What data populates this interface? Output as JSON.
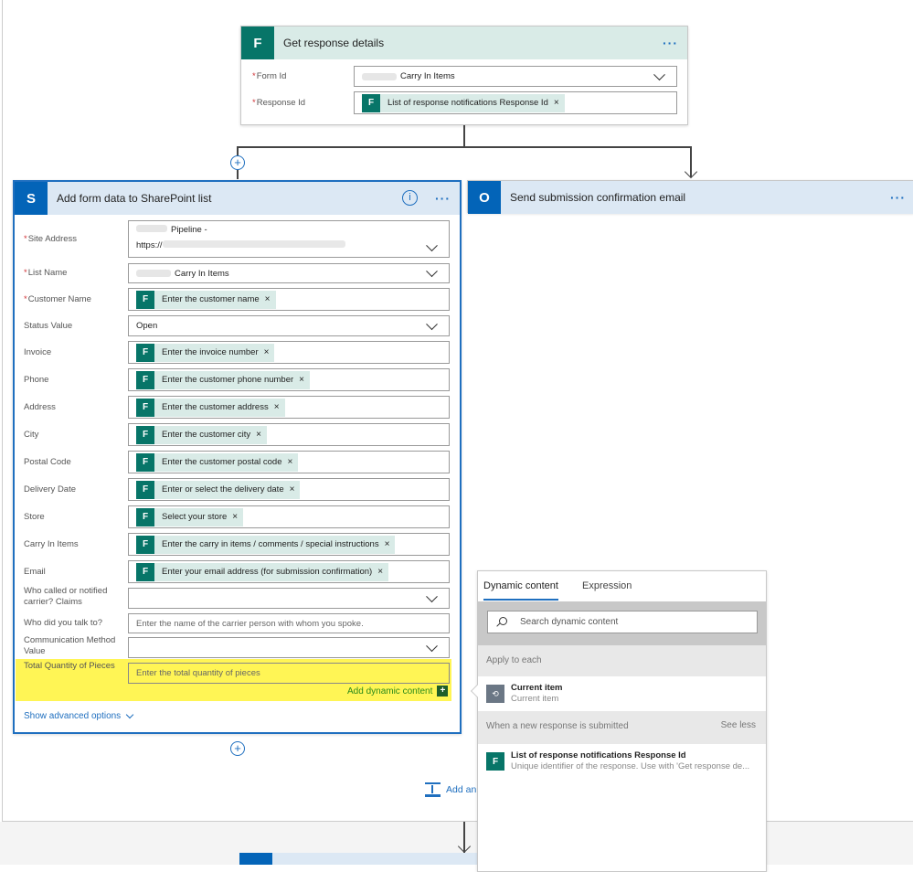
{
  "get_response": {
    "title": "Get response details",
    "icon": "forms-icon",
    "more": "···",
    "fields": [
      {
        "label": "Form Id",
        "required": true,
        "value": "Carry In Items",
        "type": "dropdown"
      },
      {
        "label": "Response Id",
        "required": true,
        "token": "List of response notifications Response Id",
        "type": "token"
      }
    ]
  },
  "sharepoint": {
    "title": "Add form data to SharePoint list",
    "icon": "sharepoint-icon",
    "icon_letter": "S",
    "info": "i",
    "more": "···",
    "site_line1": "Pipeline -",
    "site_line2": "https://",
    "fields": [
      {
        "label": "Site Address",
        "required": true,
        "type": "site"
      },
      {
        "label": "List Name",
        "required": true,
        "type": "dropdown",
        "value": "Carry In Items",
        "blur": true
      },
      {
        "label": "Customer Name",
        "required": true,
        "type": "token",
        "token": "Enter the customer name"
      },
      {
        "label": "Status Value",
        "type": "dropdown",
        "value": "Open"
      },
      {
        "label": "Invoice",
        "type": "token",
        "token": "Enter the invoice number"
      },
      {
        "label": "Phone",
        "type": "token",
        "token": "Enter the customer phone number"
      },
      {
        "label": "Address",
        "type": "token",
        "token": "Enter the customer address"
      },
      {
        "label": "City",
        "type": "token",
        "token": "Enter the customer city"
      },
      {
        "label": "Postal Code",
        "type": "token",
        "token": "Enter the customer postal code"
      },
      {
        "label": "Delivery Date",
        "type": "token",
        "token": "Enter or select the delivery date"
      },
      {
        "label": "Store",
        "type": "token",
        "token": "Select your store"
      },
      {
        "label": "Carry In Items",
        "type": "token",
        "token": "Enter the carry in items / comments / special instructions"
      },
      {
        "label": "Email",
        "type": "token",
        "token": "Enter your email address (for submission confirmation)"
      },
      {
        "label": "Who called or notified carrier? Claims",
        "type": "dropdown",
        "value": ""
      },
      {
        "label": "Who did you talk to?",
        "type": "text",
        "placeholder": "Enter the name of the carrier person with whom you spoke."
      },
      {
        "label": "Communication Method Value",
        "type": "dropdown",
        "value": ""
      },
      {
        "label": "Total Quantity of Pieces",
        "type": "text",
        "placeholder": "Enter the total quantity of pieces",
        "highlight": true
      }
    ],
    "add_dynamic": "Add dynamic content",
    "show_advanced": "Show advanced options"
  },
  "outlook": {
    "title": "Send submission confirmation email",
    "icon": "outlook-icon",
    "icon_letter": "O",
    "more": "···"
  },
  "add_action": "Add an",
  "dynamic_panel": {
    "tabs": [
      "Dynamic content",
      "Expression"
    ],
    "active_tab": 0,
    "search_placeholder": "Search dynamic content",
    "sections": [
      {
        "title": "Apply to each",
        "items": [
          {
            "title": "Current item",
            "subtitle": "Current item",
            "icon": "loop-icon"
          }
        ]
      },
      {
        "title": "When a new response is submitted",
        "action": "See less",
        "items": [
          {
            "title": "List of response notifications Response Id",
            "subtitle": "Unique identifier of the response. Use with 'Get response de...",
            "icon": "forms-icon"
          }
        ]
      }
    ]
  },
  "colors": {
    "forms": "#077568",
    "sharepoint": "#0364b8",
    "highlight": "#fff555",
    "link": "#1f6fbf"
  }
}
